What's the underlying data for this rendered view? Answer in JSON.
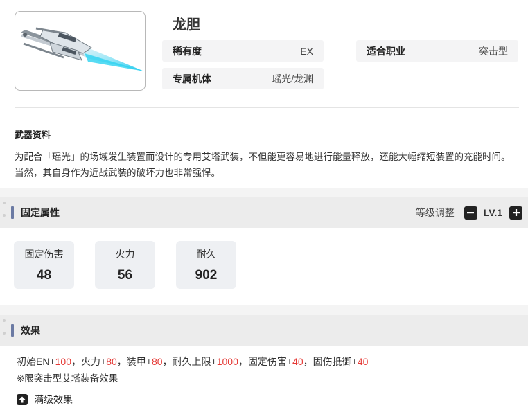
{
  "weapon": {
    "name": "龙胆",
    "image_icon": "lance-weapon-icon"
  },
  "info": {
    "rarity_key": "稀有度",
    "rarity_value": "EX",
    "class_key": "适合职业",
    "class_value": "突击型",
    "exclusive_key": "专属机体",
    "exclusive_value": "瑶光/龙渊"
  },
  "profile": {
    "label": "武器资料",
    "description": "为配合「瑶光」的场域发生装置而设计的专用艾塔武装，不但能更容易地进行能量释放，还能大幅缩短装置的充能时间。当然，其自身作为近战武装的破坏力也非常强悍。"
  },
  "fixed_attrs": {
    "title": "固定属性",
    "level_label": "等级调整",
    "level_value": "LV.1",
    "minus_icon": "minus-icon",
    "plus_icon": "plus-icon",
    "stats": [
      {
        "name": "固定伤害",
        "value": "48"
      },
      {
        "name": "火力",
        "value": "56"
      },
      {
        "name": "耐久",
        "value": "902"
      }
    ]
  },
  "effects": {
    "title": "效果",
    "items": [
      {
        "label": "初始EN",
        "value": "100",
        "sep": "，"
      },
      {
        "label": "火力",
        "value": "80",
        "sep": "，"
      },
      {
        "label": "装甲",
        "value": "80",
        "sep": "，"
      },
      {
        "label": "耐久上限",
        "value": "1000",
        "sep": "，"
      },
      {
        "label": "固定伤害",
        "value": "40",
        "sep": "，"
      },
      {
        "label": "固伤抵御",
        "value": "40",
        "sep": ""
      }
    ],
    "plus_sign": "+",
    "note": "※限突击型艾塔装备效果",
    "max_level_label": "满级效果",
    "max_level_icon": "arrow-up-icon"
  },
  "colors": {
    "accent_bar": "#6b7aa3",
    "highlight_value": "#e53935",
    "weapon_glow": "#3fd6f2"
  }
}
